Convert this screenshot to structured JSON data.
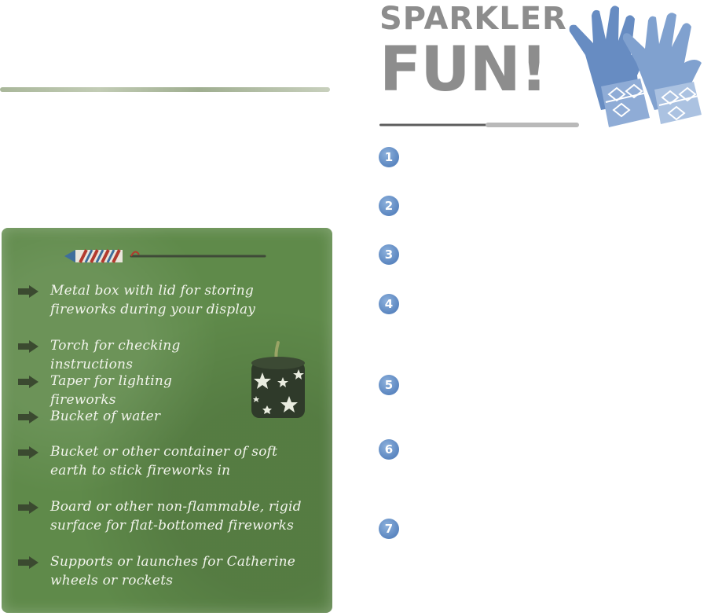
{
  "header": {
    "title_line1": "SPARKLER",
    "title_line2": "FUN!"
  },
  "steps": [
    "1",
    "2",
    "3",
    "4",
    "5",
    "6",
    "7"
  ],
  "checklist": [
    "Metal box with lid for storing fireworks during your display",
    "Torch for checking instructions",
    "Taper for lighting fireworks",
    "Bucket of water",
    "Bucket or other container of soft earth to stick fireworks in",
    "Board or other non-flammable, rigid surface for flat-bottomed fireworks",
    "Supports or launches for Catherine wheels or rockets"
  ],
  "icons": {
    "rocket": "rocket-icon",
    "bullet": "arrow-bullet-icon",
    "lantern": "star-lantern-icon",
    "gloves": "gloves-icon",
    "sparkler": "sparkler-icon"
  },
  "colors": {
    "panel_green": "#5f8a4a",
    "title_gray": "#8d8d8d",
    "step_blue": "#5b86c0",
    "glove_blue": "#5f86bf"
  }
}
